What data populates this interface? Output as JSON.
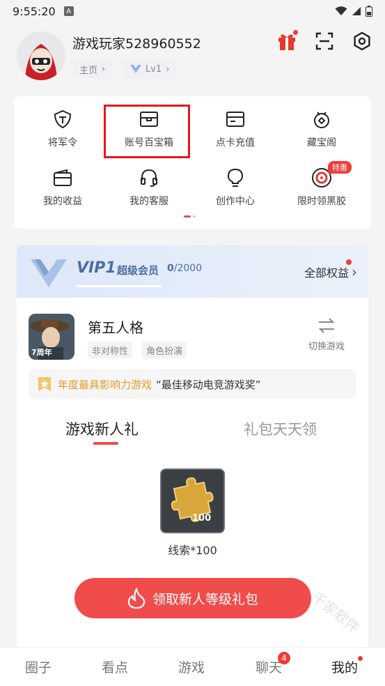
{
  "status_bar": {
    "time": "9:55:20",
    "app_glyph": "A",
    "icons": [
      "wifi-icon",
      "signal-icon",
      "battery-icon"
    ]
  },
  "profile": {
    "username": "游戏玩家528960552",
    "home_chip": "主页",
    "level_chip": "Lv1",
    "header_icons": [
      "gift-icon",
      "scan-icon",
      "settings-icon"
    ]
  },
  "grid": {
    "items": [
      {
        "label": "将军令",
        "icon": "shield-t-icon"
      },
      {
        "label": "账号百宝箱",
        "icon": "chest-icon"
      },
      {
        "label": "点卡充值",
        "icon": "card-icon"
      },
      {
        "label": "藏宝阁",
        "icon": "treasure-icon"
      },
      {
        "label": "我的收益",
        "icon": "wallet-icon"
      },
      {
        "label": "我的客服",
        "icon": "headset-icon"
      },
      {
        "label": "创作中心",
        "icon": "bulb-icon"
      },
      {
        "label": "限时领黑胶",
        "icon": "vinyl-icon"
      }
    ],
    "badge": "特惠"
  },
  "vip": {
    "title": "VIP1",
    "subtitle": "超级会员",
    "progress_current": "0",
    "progress_total": "/2000",
    "rights_label": "全部权益"
  },
  "game": {
    "name": "第五人格",
    "tags": [
      "非对称性",
      "角色扮演"
    ],
    "switch_label": "切换游戏",
    "icon_text": "7周年"
  },
  "award": {
    "highlight": "年度最具影响力游戏",
    "text": "“最佳移动电竞游戏奖”"
  },
  "tabs": {
    "active": "游戏新人礼",
    "inactive": "礼包天天领"
  },
  "reward": {
    "label": "线索*100",
    "tile_number": "100"
  },
  "claim_button": "领取新人等级礼包",
  "bottom_nav": {
    "items": [
      "圈子",
      "看点",
      "游戏",
      "聊天",
      "我的"
    ],
    "chat_badge": "4"
  },
  "watermark": "千家软件",
  "colors": {
    "accent_red": "#f04c4c",
    "vip_blue": "#4a6fa5",
    "award_orange": "#e79a2c",
    "highlight_box": "#e8161c"
  }
}
